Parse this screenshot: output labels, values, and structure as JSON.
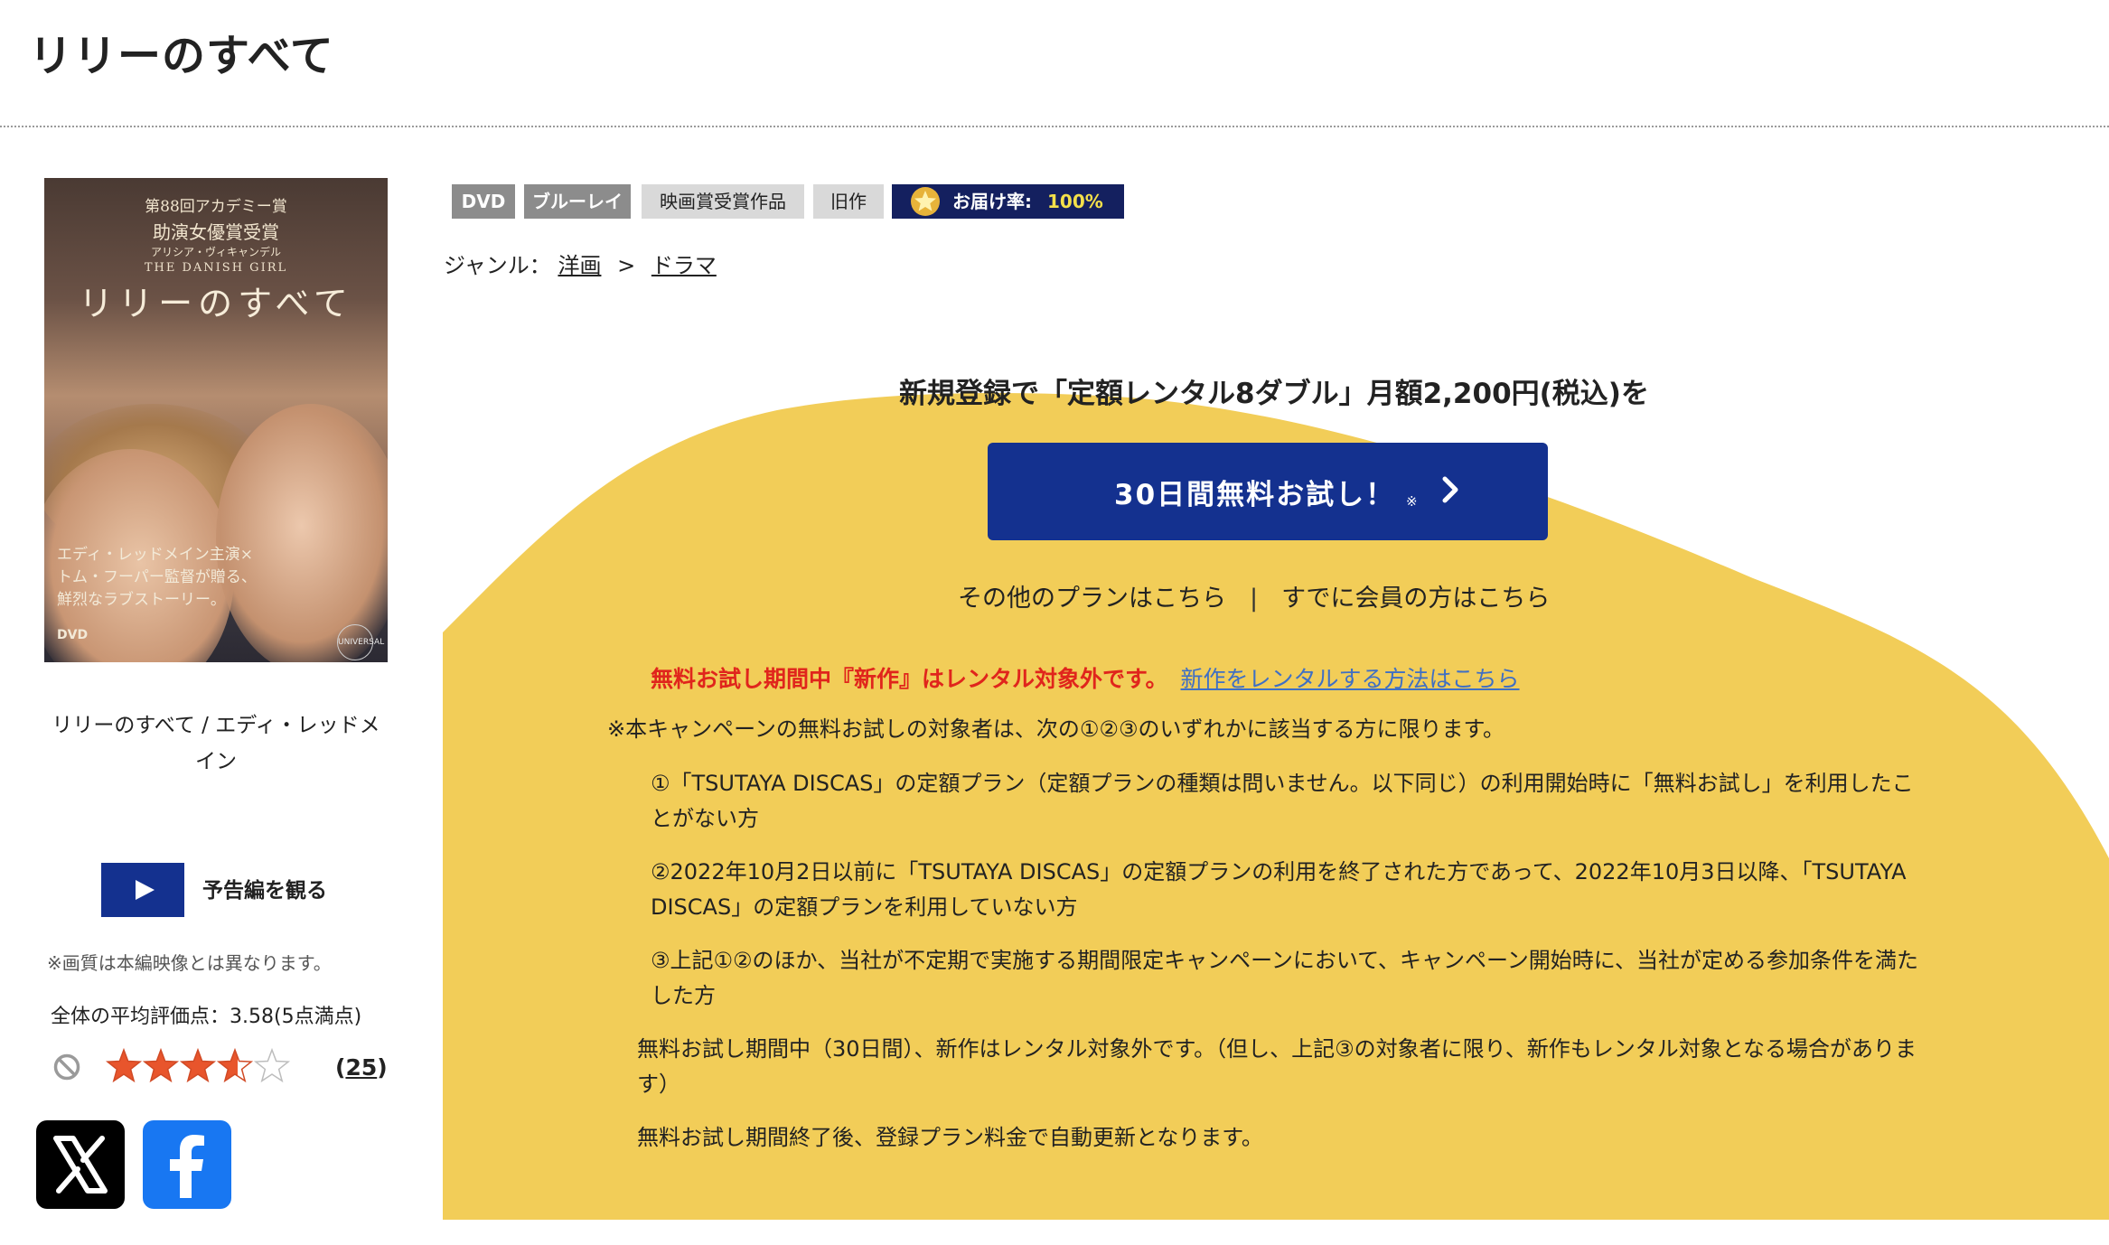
{
  "page": {
    "title": "リリーのすべて"
  },
  "poster": {
    "award_line1": "第88回アカデミー賞",
    "award_line2": "助演女優賞受賞",
    "award_line3": "アリシア・ヴィキャンデル",
    "english_title": "THE DANISH GIRL",
    "jp_title": "リリーのすべて",
    "credit_line1": "エディ・レッドメイン主演×",
    "credit_line2": "トム・フーパー監督が贈る、",
    "credit_line3": "鮮烈なラブストーリー。",
    "format_mark": "DVD",
    "studio_mark": "UNIVERSAL"
  },
  "item": {
    "name": "リリーのすべて / エディ・レッドメイン"
  },
  "trailer": {
    "label": "予告編を観る"
  },
  "notes": {
    "picture_quality": "※画質は本編映像とは異なります。"
  },
  "rating": {
    "label": "全体の平均評価点：",
    "value_text": "3.58(5点満点)",
    "average": 3.58,
    "max": 5,
    "review_count": "25",
    "open_paren": "(",
    "close_paren": ")",
    "star_color": "#e8552c"
  },
  "share": {
    "x_icon": "x-logo-icon",
    "facebook_icon": "facebook-logo-icon",
    "x_color": "#000000",
    "facebook_color": "#1877f2"
  },
  "badges": [
    {
      "label": "DVD"
    },
    {
      "label": "ブルーレイ"
    },
    {
      "label": "映画賞受賞作品"
    },
    {
      "label": "旧作"
    },
    {
      "label": "お届け率:",
      "value": "100%"
    }
  ],
  "genre": {
    "label": "ジャンル：",
    "parent": "洋画",
    "arrow": ">",
    "child": "ドラマ"
  },
  "promo": {
    "heading": "新規登録で「定額レンタル8ダブル」月額2,200円(税込)を",
    "cta_label": "30日間無料お試し！",
    "cta_note": "※",
    "other_plans": "その他のプランはこちら",
    "separator": "|",
    "members_link": "すでに会員の方はこちら",
    "warning": "無料お試し期間中『新作』はレンタル対象外です。",
    "warning_link": "新作をレンタルする方法はこちら",
    "bg_color": "#f2cd58",
    "button_color": "#14318f"
  },
  "terms": {
    "intro": "※本キャンペーンの無料お試しの対象者は、次の①②③のいずれかに該当する方に限ります。",
    "item1": "①「TSUTAYA DISCAS」の定額プラン（定額プランの種類は問いません。以下同じ）の利用開始時に「無料お試し」を利用したことがない方",
    "item2": "②2022年10月2日以前に「TSUTAYA DISCAS」の定額プランの利用を終了された方であって、2022年10月3日以降、「TSUTAYA DISCAS」の定額プランを利用していない方",
    "item3": "③上記①②のほか、当社が不定期で実施する期間限定キャンペーンにおいて、キャンペーン開始時に、当社が定める参加条件を満たした方",
    "note1": "無料お試し期間中（30日間）、新作はレンタル対象外です。（但し、上記③の対象者に限り、新作もレンタル対象となる場合があります）",
    "note2": "無料お試し期間終了後、登録プラン料金で自動更新となります。"
  }
}
